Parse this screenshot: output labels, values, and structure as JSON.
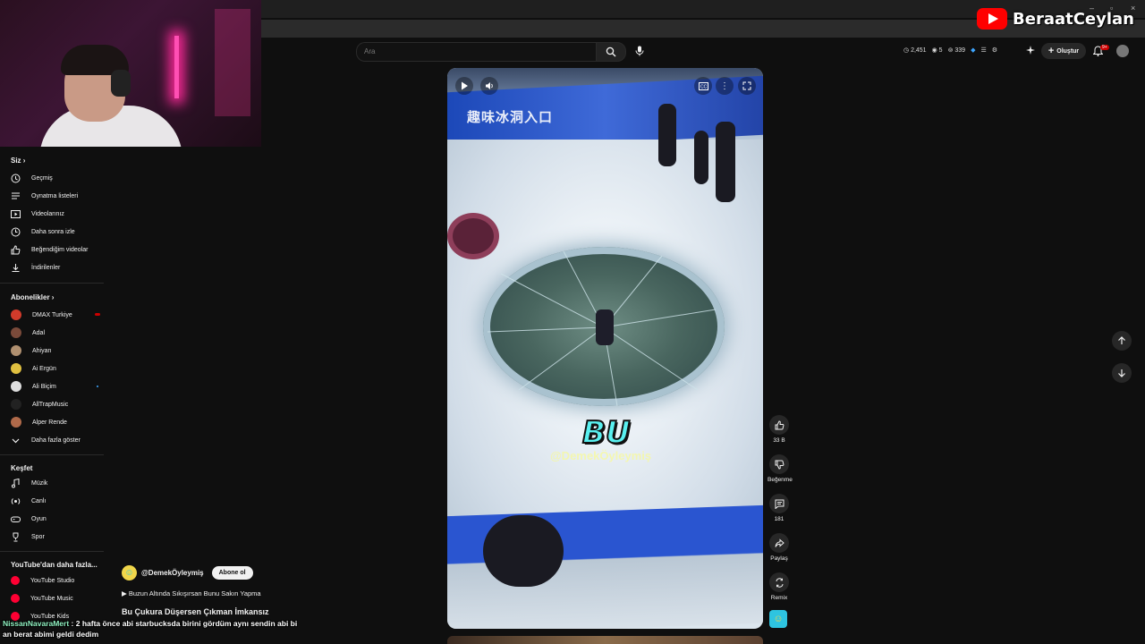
{
  "overlay": {
    "brand_name": "BeraatCeylan",
    "chat_user": "NissanNavaraMert",
    "chat_message": " : 2 hafta önce abi starbucksda birini gördüm aynı sendin abi bi an berat abimi geldi dedim"
  },
  "header": {
    "search_placeholder": "Ara",
    "stat_views": "2,451",
    "stat_a": "5",
    "stat_b": "339",
    "create_label": "Oluştur",
    "notif_count": "9+"
  },
  "sidebar": {
    "you_title": "Siz",
    "you_items": [
      {
        "label": "Geçmiş",
        "icon": "history-icon"
      },
      {
        "label": "Oynatma listeleri",
        "icon": "playlists-icon"
      },
      {
        "label": "Videolarınız",
        "icon": "your-videos-icon"
      },
      {
        "label": "Daha sonra izle",
        "icon": "watch-later-icon"
      },
      {
        "label": "Beğendiğim videolar",
        "icon": "liked-videos-icon"
      },
      {
        "label": "İndirilenler",
        "icon": "downloads-icon"
      }
    ],
    "subs_title": "Abonelikler",
    "subs_items": [
      {
        "label": "DMAX Turkiye",
        "color": "#d23b2b"
      },
      {
        "label": "Adal",
        "color": "#7a4a3a"
      },
      {
        "label": "Ahiyan",
        "color": "#b09070"
      },
      {
        "label": "Ai Ergün",
        "color": "#e0c040"
      },
      {
        "label": "Ali Biçim",
        "color": "#dddddd"
      },
      {
        "label": "AllTrapMusic",
        "color": "#222222"
      },
      {
        "label": "Alper Rende",
        "color": "#b06a4a"
      }
    ],
    "show_more": "Daha fazla göster",
    "explore_title": "Keşfet",
    "explore_items": [
      {
        "label": "Müzik",
        "icon": "music-icon"
      },
      {
        "label": "Canlı",
        "icon": "live-icon"
      },
      {
        "label": "Oyun",
        "icon": "gaming-icon"
      },
      {
        "label": "Spor",
        "icon": "trophy-icon"
      }
    ],
    "more_title": "YouTube'dan daha fazla...",
    "more_items": [
      {
        "label": "YouTube Studio"
      },
      {
        "label": "YouTube Music"
      },
      {
        "label": "YouTube Kids"
      }
    ]
  },
  "short": {
    "caption_big": "BU",
    "watermark": "@DemekÖyleymiş",
    "banner_text": "趣味冰洞入口",
    "channel_handle": "@DemekÖyleymiş",
    "subscribe_label": "Abone ol",
    "music": "▶ Buzun Altında Sıkışırsan Bunu Sakın Yapma",
    "title": "Bu Çukura Düşersen Çıkman İmkansız"
  },
  "actions": {
    "like_count": "33 B",
    "dislike_label": "Beğenme",
    "comments_count": "181",
    "share_label": "Paylaş",
    "remix_label": "Remix"
  },
  "colors": {
    "background": "#0f0f0f",
    "accent_red": "#ff0000",
    "subscribe_bg": "#f1f1f1"
  }
}
